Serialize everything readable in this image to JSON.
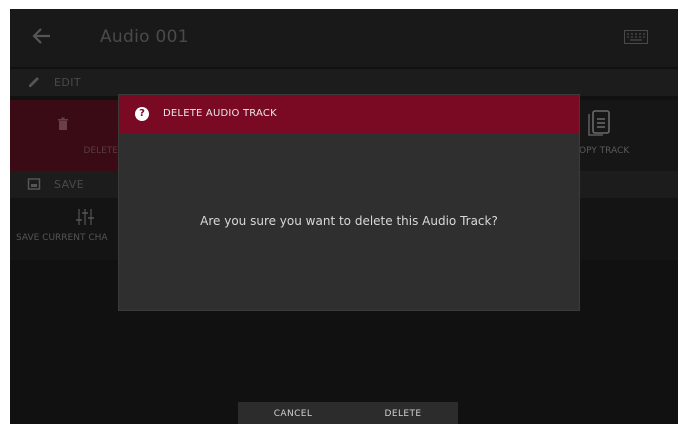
{
  "header": {
    "title": "Audio 001",
    "back_icon": "arrow-left-icon",
    "keyboard_icon": "keyboard-icon"
  },
  "edit_section": {
    "label": "EDIT",
    "icon": "pencil-icon",
    "delete_tile": {
      "label": "DELETE",
      "icon": "trash-icon"
    },
    "copy_tile": {
      "label": "OPY TRACK",
      "icon": "copy-document-icon"
    }
  },
  "save_section": {
    "label": "SAVE",
    "icon": "save-icon",
    "save_tile": {
      "label": "SAVE CURRENT CHA",
      "icon": "sliders-icon"
    }
  },
  "dialog": {
    "title": "DELETE AUDIO TRACK",
    "icon": "question-circle-icon",
    "icon_glyph": "?",
    "message": "Are you sure you want to delete this Audio Track?"
  },
  "buttons": {
    "cancel": "CANCEL",
    "delete": "DELETE"
  },
  "colors": {
    "accent": "#7a0a24",
    "background": "#111111",
    "dialog": "#2f2f2f"
  }
}
